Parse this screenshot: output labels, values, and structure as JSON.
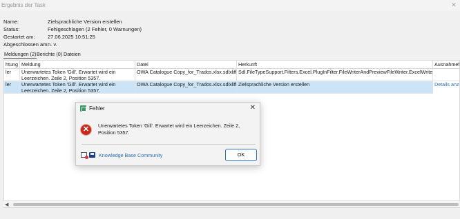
{
  "window": {
    "title": "Ergebnis der Task",
    "close_glyph": "✕"
  },
  "info": [
    {
      "label": "Name:",
      "value": "Zielsprachliche Version erstellen"
    },
    {
      "label": "Status:",
      "value": "Fehlgeschlagen (2 Fehler, 0 Warnungen)"
    },
    {
      "label": "Gestartet am:",
      "value": "27.06.2025 10:51:25"
    },
    {
      "label": "Abgeschlossen am:",
      "value": "n. v."
    }
  ],
  "tabs": [
    {
      "label": "Meldungen (2)",
      "active": true
    },
    {
      "label": "Berichte (0)",
      "active": false
    },
    {
      "label": "Dateien",
      "active": false
    }
  ],
  "grid": {
    "columns": [
      "htung",
      "Meldung",
      "Datei",
      "Herkunft",
      "Ausnahmefe"
    ],
    "rows": [
      {
        "severity": "ler",
        "message": "Unerwartetes Token 'Gill'. Erwartet wird ein Leerzeichen. Zeile 2, Position 5357.",
        "file": "OWA Catalogue Copy_for_Trados.xlsx.sdlxliff",
        "source": "Sdl.FileTypeSupport.Filters.Excel.PlugInFilter.FileWriterAndPreviewFileWriter.ExcelWriter",
        "exception": ""
      },
      {
        "severity": "ler",
        "message": "Unerwartetes Token 'Gill'. Erwartet wird ein Leerzeichen. Zeile 2, Position 5357.",
        "file": "OWA Catalogue Copy_for_Trados.xlsx.sdlxliff",
        "source": "Zielsprachliche Version erstellen",
        "exception": "Details anzei"
      }
    ]
  },
  "scrollbar": {
    "left_arrow": "◀"
  },
  "dialog": {
    "title": "Fehler",
    "close_glyph": "✕",
    "error_glyph": "✕",
    "message": "Unerwartetes Token 'Gill'. Erwartet wird ein Leerzeichen. Zeile 2, Position 5357.",
    "links": [
      "Knowledge Base",
      "Community"
    ],
    "ok_label": "OK"
  },
  "colors": {
    "selection": "#cce4f7",
    "link": "#2a6fb5",
    "error": "#c42b1c",
    "app_icon": "#2f9e5a"
  }
}
